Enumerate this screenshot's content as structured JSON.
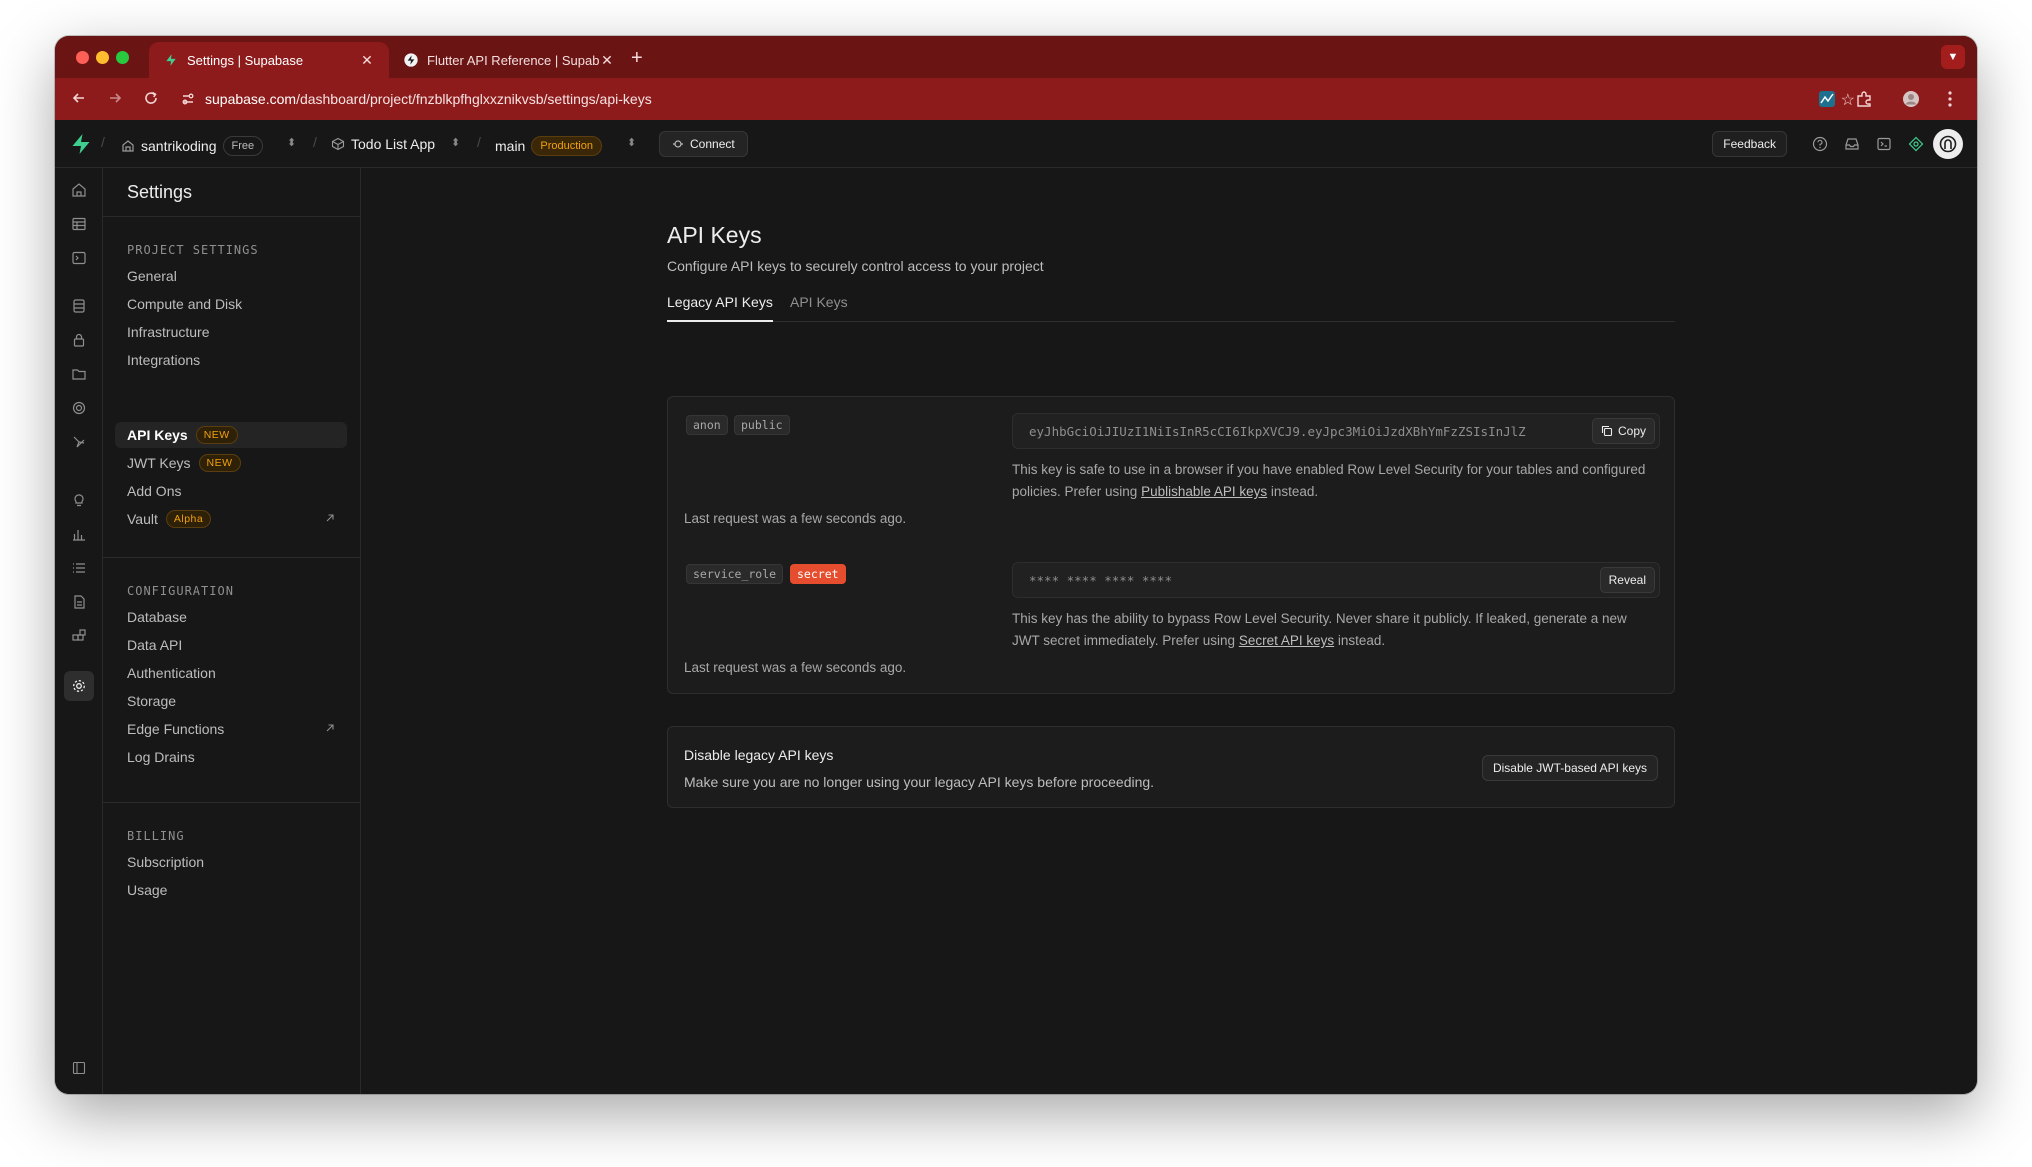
{
  "browser": {
    "tabs": [
      {
        "title": "Settings | Supabase",
        "active": true
      },
      {
        "title": "Flutter API Reference | Supab",
        "active": false
      }
    ],
    "url_domain": "supabase.com",
    "url_path": "/dashboard/project/fnzblkpfhglxxznikvsb/settings/api-keys"
  },
  "header": {
    "org_name": "santrikoding",
    "org_plan": "Free",
    "project_name": "Todo List App",
    "branch_name": "main",
    "branch_env": "Production",
    "connect_label": "Connect",
    "feedback_label": "Feedback"
  },
  "sidebar": {
    "title": "Settings",
    "sections": [
      {
        "label": "PROJECT SETTINGS",
        "items": [
          {
            "label": "General"
          },
          {
            "label": "Compute and Disk"
          },
          {
            "label": "Infrastructure"
          },
          {
            "label": "Integrations"
          },
          {
            "label": "API Keys",
            "badge": "NEW",
            "active": true
          },
          {
            "label": "JWT Keys",
            "badge": "NEW"
          },
          {
            "label": "Add Ons"
          },
          {
            "label": "Vault",
            "badge": "Alpha",
            "external": true
          }
        ]
      },
      {
        "label": "CONFIGURATION",
        "items": [
          {
            "label": "Database"
          },
          {
            "label": "Data API"
          },
          {
            "label": "Authentication"
          },
          {
            "label": "Storage"
          },
          {
            "label": "Edge Functions",
            "external": true
          },
          {
            "label": "Log Drains"
          }
        ]
      },
      {
        "label": "BILLING",
        "items": [
          {
            "label": "Subscription"
          },
          {
            "label": "Usage"
          }
        ]
      }
    ]
  },
  "page": {
    "title": "API Keys",
    "description": "Configure API keys to securely control access to your project",
    "tabs": [
      {
        "label": "Legacy API Keys",
        "active": true
      },
      {
        "label": "API Keys",
        "active": false
      }
    ]
  },
  "keys": [
    {
      "chips": [
        "anon",
        "public"
      ],
      "value": "eyJhbGciOiJIUzI1NiIsInR5cCI6IkpXVCJ9.eyJpc3MiOiJzdXBhYmFzZSIsInJlZ",
      "button": "Copy",
      "help_before": "This key is safe to use in a browser if you have enabled Row Level Security for your tables and configured policies. Prefer using ",
      "help_link": "Publishable API keys",
      "help_after": " instead.",
      "last_request": "Last request was a few seconds ago."
    },
    {
      "chips": [
        "service_role",
        "secret"
      ],
      "value": "**** **** **** ****",
      "button": "Reveal",
      "help_before": "This key has the ability to bypass Row Level Security. Never share it publicly. If leaked, generate a new JWT secret immediately. Prefer using ",
      "help_link": "Secret API keys",
      "help_after": " instead.",
      "last_request": "Last request was a few seconds ago."
    }
  ],
  "disable_legacy": {
    "title": "Disable legacy API keys",
    "description": "Make sure you are no longer using your legacy API keys before proceeding.",
    "button": "Disable JWT-based API keys"
  },
  "colors": {
    "chrome_tabbar": "#6b1414",
    "chrome_toolbar": "#8e1b1b",
    "app_bg": "#171717",
    "brand_green": "#3ecf8e",
    "accent_orange": "#f1a10d",
    "secret_red": "#e54d2e"
  }
}
